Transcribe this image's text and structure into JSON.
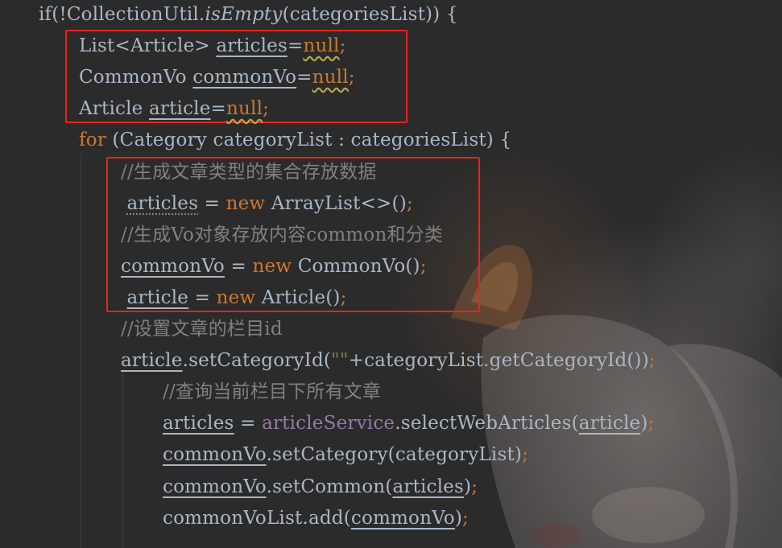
{
  "colors": {
    "background": "#2b2b2b",
    "default_text": "#a9b7c6",
    "keyword": "#cc7832",
    "comment": "#808080",
    "field": "#9876aa",
    "string": "#6a8759",
    "highlight_box": "#e8231c"
  },
  "code_lines": [
    {
      "tokens": [
        {
          "t": "if(!CollectionUtil.",
          "c": "def"
        },
        {
          "t": "isEmpty",
          "c": "it"
        },
        {
          "t": "(categoriesList)) {",
          "c": "def"
        }
      ]
    },
    {
      "tokens": [
        {
          "t": "List<Article> ",
          "c": "def"
        },
        {
          "t": "articles",
          "c": "u"
        },
        {
          "t": "=",
          "c": "def"
        },
        {
          "t": "null",
          "c": "nullkw"
        },
        {
          "t": ";",
          "c": "semi"
        }
      ]
    },
    {
      "tokens": [
        {
          "t": "CommonVo ",
          "c": "def"
        },
        {
          "t": "commonVo",
          "c": "u"
        },
        {
          "t": "=",
          "c": "def"
        },
        {
          "t": "null",
          "c": "nullkw"
        },
        {
          "t": ";",
          "c": "semi"
        }
      ]
    },
    {
      "tokens": [
        {
          "t": "Article ",
          "c": "def"
        },
        {
          "t": "article",
          "c": "u"
        },
        {
          "t": "=",
          "c": "def"
        },
        {
          "t": "null",
          "c": "nullkw"
        },
        {
          "t": ";",
          "c": "semi"
        }
      ]
    },
    {
      "tokens": [
        {
          "t": "for",
          "c": "kw"
        },
        {
          "t": " (Category categoryList : categoriesList) {",
          "c": "def"
        }
      ]
    },
    {
      "tokens": [
        {
          "t": "//生成文章类型的集合存放数据",
          "c": "cmt"
        }
      ]
    },
    {
      "tokens": [
        {
          "t": " ",
          "c": "def"
        },
        {
          "t": "articles",
          "c": "ud"
        },
        {
          "t": " = ",
          "c": "def"
        },
        {
          "t": "new",
          "c": "kw"
        },
        {
          "t": " ArrayList<>()",
          "c": "def"
        },
        {
          "t": ";",
          "c": "semi"
        }
      ]
    },
    {
      "tokens": [
        {
          "t": "//生成Vo对象存放内容common和分类",
          "c": "cmt"
        }
      ]
    },
    {
      "tokens": [
        {
          "t": "commonVo",
          "c": "u"
        },
        {
          "t": " = ",
          "c": "def"
        },
        {
          "t": "new",
          "c": "kw"
        },
        {
          "t": " CommonVo()",
          "c": "def"
        },
        {
          "t": ";",
          "c": "semi"
        }
      ]
    },
    {
      "tokens": [
        {
          "t": " ",
          "c": "def"
        },
        {
          "t": "article",
          "c": "u"
        },
        {
          "t": " = ",
          "c": "def"
        },
        {
          "t": "new",
          "c": "kw"
        },
        {
          "t": " Article()",
          "c": "def"
        },
        {
          "t": ";",
          "c": "semi"
        }
      ]
    },
    {
      "tokens": [
        {
          "t": "//设置文章的栏目id",
          "c": "cmt"
        }
      ]
    },
    {
      "tokens": [
        {
          "t": "article",
          "c": "u"
        },
        {
          "t": ".setCategoryId(",
          "c": "def"
        },
        {
          "t": "\"\"",
          "c": "str"
        },
        {
          "t": "+categoryList.getCategoryId())",
          "c": "def"
        },
        {
          "t": ";",
          "c": "semi"
        }
      ]
    },
    {
      "tokens": [
        {
          "t": "//查询当前栏目下所有文章",
          "c": "cmt"
        }
      ]
    },
    {
      "tokens": [
        {
          "t": "articles",
          "c": "u"
        },
        {
          "t": " = ",
          "c": "def"
        },
        {
          "t": "articleService",
          "c": "fld"
        },
        {
          "t": ".selectWebArticles(",
          "c": "def"
        },
        {
          "t": "article",
          "c": "u"
        },
        {
          "t": ")",
          "c": "def"
        },
        {
          "t": ";",
          "c": "semi"
        }
      ]
    },
    {
      "tokens": [
        {
          "t": "commonVo",
          "c": "u"
        },
        {
          "t": ".setCategory(categoryList)",
          "c": "def"
        },
        {
          "t": ";",
          "c": "semi"
        }
      ]
    },
    {
      "tokens": [
        {
          "t": "commonVo",
          "c": "u"
        },
        {
          "t": ".setCommon(",
          "c": "def"
        },
        {
          "t": "articles",
          "c": "u"
        },
        {
          "t": ")",
          "c": "def"
        },
        {
          "t": ";",
          "c": "semi"
        }
      ]
    },
    {
      "tokens": [
        {
          "t": "commonVoList.add(",
          "c": "def"
        },
        {
          "t": "commonVo",
          "c": "u"
        },
        {
          "t": ")",
          "c": "def"
        },
        {
          "t": ";",
          "c": "semi"
        }
      ]
    }
  ],
  "highlight_boxes": [
    {
      "label": "declarations-box"
    },
    {
      "label": "initializations-box"
    }
  ],
  "background_art": {
    "icon": "anime-girl-wallpaper"
  }
}
